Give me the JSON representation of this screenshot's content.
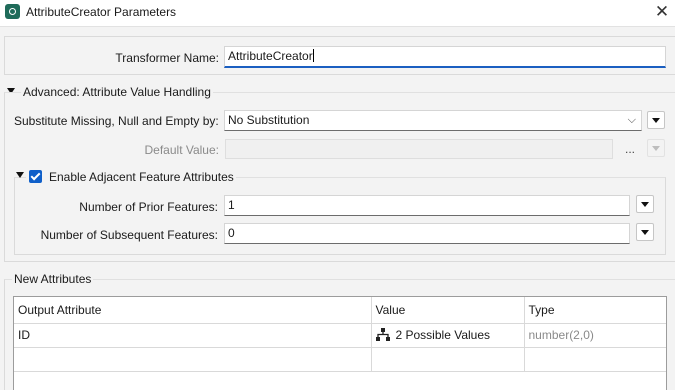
{
  "window": {
    "title": "AttributeCreator Parameters"
  },
  "transformer": {
    "label": "Transformer Name:",
    "value": "AttributeCreator"
  },
  "advanced": {
    "section_title": "Advanced: Attribute Value Handling",
    "substitute_label": "Substitute Missing, Null and Empty by:",
    "substitute_value": "No Substitution",
    "default_label": "Default Value:",
    "default_value": "",
    "ellipsis": "...",
    "adjacent": {
      "title": "Enable Adjacent Feature Attributes",
      "checked": true,
      "prior_label": "Number of Prior Features:",
      "prior_value": "1",
      "subsequent_label": "Number of Subsequent Features:",
      "subsequent_value": "0"
    }
  },
  "new_attributes": {
    "section_title": "New Attributes",
    "columns": [
      "Output Attribute",
      "Value",
      "Type"
    ],
    "rows": [
      {
        "output": "ID",
        "value": "2 Possible Values",
        "value_icon": "tree-icon",
        "type": "number(2,0)"
      }
    ]
  },
  "colors": {
    "accent": "#0f5fc9",
    "focus_underline": "#1b5fc1"
  }
}
